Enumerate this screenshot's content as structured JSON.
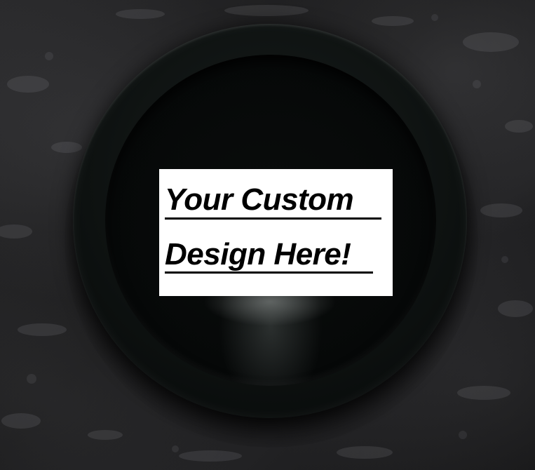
{
  "design_card": {
    "line1": "Your Custom",
    "line2": "Design Here!"
  },
  "colors": {
    "background": "#1c1c1d",
    "plate": "#0a0d0c",
    "card": "#ffffff",
    "text": "#000000"
  }
}
